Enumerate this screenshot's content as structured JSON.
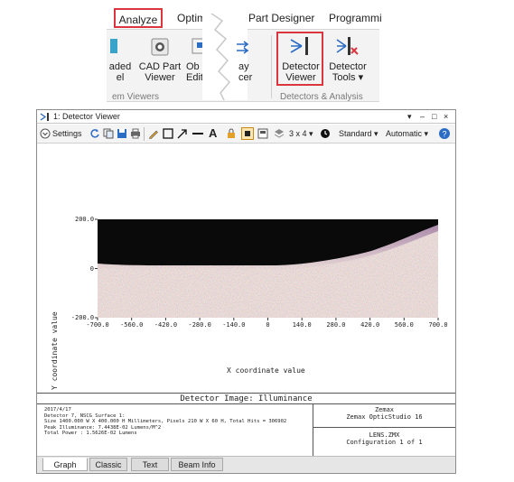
{
  "ribbon": {
    "tabs": [
      "Analyze",
      "Optim",
      "Part Designer",
      "Programmi"
    ],
    "buttons": {
      "b1_line1": "aded",
      "b1_line2": "el",
      "cad_line1": "CAD Part",
      "cad_line2": "Viewer",
      "obj_line1": "Ob",
      "obj_line2": "Edit",
      "ray_line1": "ay",
      "ray_line2": "cer",
      "detector_viewer_line1": "Detector",
      "detector_viewer_line2": "Viewer",
      "detector_tools_line1": "Detector",
      "detector_tools_line2": "Tools ▾"
    },
    "groups": {
      "viewers": "em Viewers",
      "detectors": "Detectors & Analysis"
    }
  },
  "window": {
    "title": "1: Detector Viewer",
    "controls": [
      "▾",
      "–",
      "□",
      "×"
    ]
  },
  "toolbar": {
    "settings": "Settings",
    "grid": "3 x 4 ▾",
    "standard": "Standard ▾",
    "automatic": "Automatic ▾"
  },
  "chart_data": {
    "type": "heatmap",
    "xlabel": "X coordinate value",
    "ylabel": "Y coordinate value",
    "xlim": [
      -700,
      700
    ],
    "ylim": [
      -200,
      200
    ],
    "xticks": [
      "-700.0",
      "-560.0",
      "-420.0",
      "-280.0",
      "-140.0",
      "0",
      "140.0",
      "280.0",
      "420.0",
      "560.0",
      "700.0"
    ],
    "yticks": [
      "200.0",
      "0",
      "-200.0"
    ]
  },
  "info": {
    "title": "Detector Image: Illuminance",
    "lines": [
      "2017/4/17",
      "Detector 7, NSCG Surface 1:",
      "Size 1400.000 W X 400.000 H Millimeters, Pixels 210 W X 60 H, Total Hits = 306902",
      "Peak Illuminance: 7.4438E-02 Lumens/M^2",
      "Total Power     : 1.5626E-02 Lumens"
    ],
    "zemax_line1": "Zemax",
    "zemax_line2": "Zemax OpticStudio 16",
    "file": "LENS.ZMX",
    "config": "Configuration 1 of 1"
  },
  "bottom_tabs": [
    "Graph",
    "Classic",
    "Text",
    "Beam Info"
  ],
  "colors": {
    "accent_red": "#d9363e",
    "toolbar_icon_blue": "#2b6cc4"
  }
}
